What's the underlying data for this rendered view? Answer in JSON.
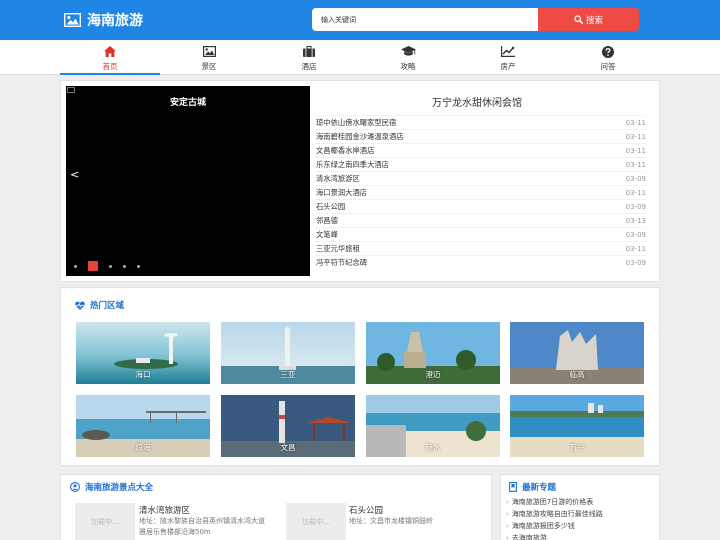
{
  "header": {
    "site_title": "海南旅游",
    "search_placeholder": "输入关键词",
    "search_button": "搜索"
  },
  "nav": [
    {
      "label": "首页",
      "icon": "home-icon",
      "active": true
    },
    {
      "label": "景区",
      "icon": "image-icon",
      "active": false
    },
    {
      "label": "酒店",
      "icon": "suitcase-icon",
      "active": false
    },
    {
      "label": "攻略",
      "icon": "graduation-cap-icon",
      "active": false
    },
    {
      "label": "房产",
      "icon": "line-chart-icon",
      "active": false
    },
    {
      "label": "问答",
      "icon": "question-circle-icon",
      "active": false
    }
  ],
  "slider": {
    "caption": "安定古城",
    "prev_arrow": "<",
    "dot_count": 5,
    "active_dot": 2
  },
  "news": {
    "title": "万宁龙水甜休闲会馆",
    "items": [
      {
        "title": "琼中依山傍水曙家型民宿",
        "date": "03-11"
      },
      {
        "title": "海南碧桂园金沙滩温泉酒店",
        "date": "03-11"
      },
      {
        "title": "文昌椰香水岸酒店",
        "date": "03-11"
      },
      {
        "title": "乐东绿之南四季大酒店",
        "date": "03-11"
      },
      {
        "title": "清水湾旅游区",
        "date": "03-09"
      },
      {
        "title": "海口景润大酒店",
        "date": "03-11"
      },
      {
        "title": "石头公园",
        "date": "03-09"
      },
      {
        "title": "邻昌德",
        "date": "03-13"
      },
      {
        "title": "文笔峰",
        "date": "03-09"
      },
      {
        "title": "三亚元华旅租",
        "date": "03-11"
      },
      {
        "title": "冯平符节纪念碑",
        "date": "03-09"
      }
    ]
  },
  "hot_areas": {
    "title": "热门区域",
    "items": [
      "海口",
      "三亚",
      "澄迈",
      "临高",
      "琼海",
      "文昌",
      "陵水",
      "万宁"
    ]
  },
  "spots": {
    "title": "海南旅游景点大全",
    "loading_text": "加载中...",
    "items": [
      {
        "name": "清水湾旅游区",
        "address": "地址：陵水黎族自治县英州镇清水湾大道雅居乐售楼部沿海50m"
      },
      {
        "name": "石头公园",
        "address": "地址：文昌市龙楼镇铜鼓岭"
      }
    ]
  },
  "topics": {
    "title": "最新专题",
    "items": [
      "海南旅游团7日游的价格表",
      "海南旅游攻略自由行最佳线路",
      "海南旅游报团多少钱",
      "去海南旅游"
    ]
  },
  "colors": {
    "brand_blue": "#1f86e6",
    "search_red": "#ef4b45",
    "active_red": "#e0322b",
    "section_blue": "#1f6fd0"
  }
}
